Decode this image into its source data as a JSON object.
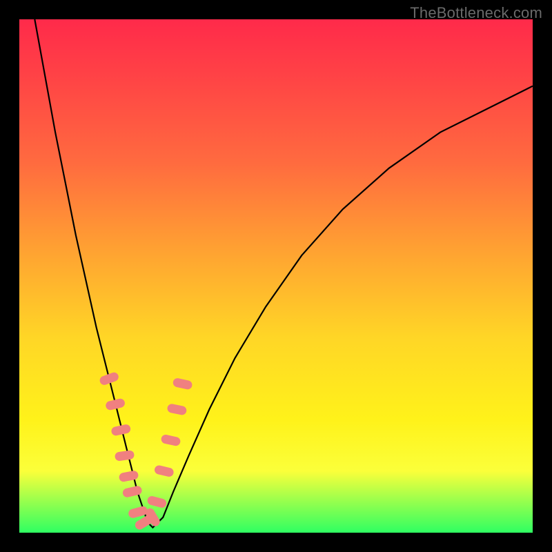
{
  "watermark": "TheBottleneck.com",
  "colors": {
    "frame": "#000000",
    "curve": "#000000",
    "marker_fill": "#f08080",
    "marker_stroke": "#e06a6a"
  },
  "chart_data": {
    "type": "line",
    "title": "",
    "xlabel": "",
    "ylabel": "",
    "xlim": [
      0,
      100
    ],
    "ylim": [
      0,
      100
    ],
    "grid": false,
    "legend": false,
    "series": [
      {
        "name": "bottleneck-curve",
        "x": [
          3,
          5,
          7,
          9,
          11,
          13,
          15,
          17,
          19,
          21,
          22,
          23,
          24,
          25,
          26,
          28,
          30,
          33,
          37,
          42,
          48,
          55,
          63,
          72,
          82,
          92,
          100
        ],
        "y": [
          100,
          89,
          78,
          68,
          58,
          49,
          40,
          32,
          24,
          16,
          12,
          8,
          5,
          2,
          1,
          3,
          8,
          15,
          24,
          34,
          44,
          54,
          63,
          71,
          78,
          83,
          87
        ]
      }
    ],
    "markers": {
      "name": "highlighted-points",
      "shape": "rounded-rect",
      "x": [
        17.5,
        18.7,
        19.8,
        20.5,
        21.3,
        22.0,
        23.1,
        24.3,
        26.0,
        26.8,
        28.2,
        29.5,
        30.7,
        31.8
      ],
      "y": [
        30,
        25,
        20,
        15,
        11,
        8,
        4,
        2,
        3,
        6,
        12,
        18,
        24,
        29
      ]
    }
  }
}
